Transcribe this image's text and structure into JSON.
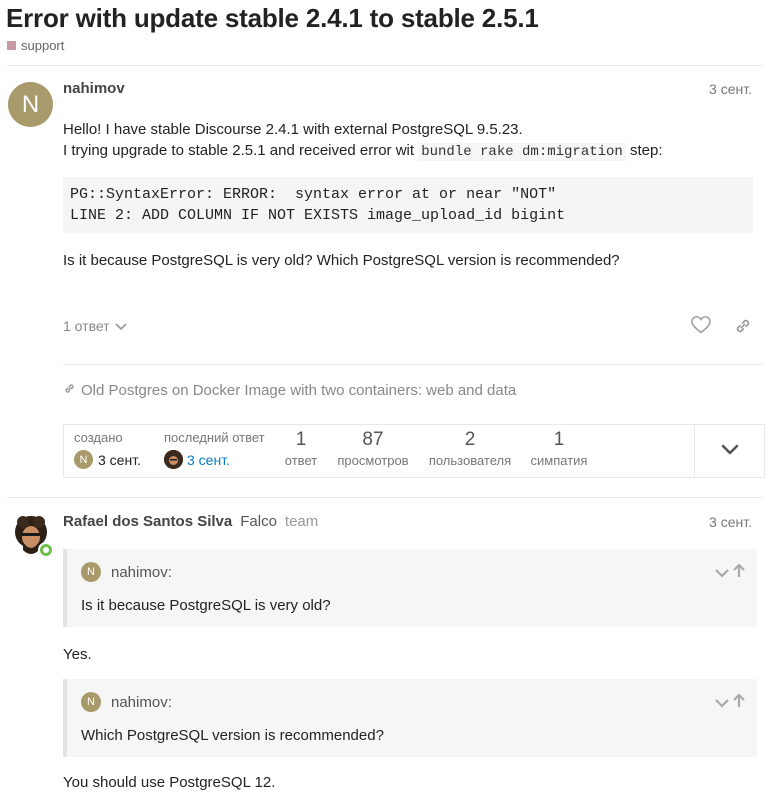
{
  "topic": {
    "title": "Error with update stable 2.4.1 to stable 2.5.1",
    "category": "support",
    "category_color": "#c99aa4"
  },
  "post1": {
    "avatar_letter": "N",
    "avatar_color": "#a89a6a",
    "username": "nahimov",
    "date": "3 сент.",
    "line1": "Hello! I have stable Discourse 2.4.1 with external PostgreSQL 9.5.23.",
    "line2_before": "I trying upgrade to stable 2.5.1 and received error wit ",
    "line2_code": "bundle rake dm:migration",
    "line2_after": " step:",
    "code_line1": "PG::SyntaxError: ERROR:  syntax error at or near \"NOT\"",
    "code_line2": "LINE 2: ADD COLUMN IF NOT EXISTS image_upload_id bigint",
    "question": "Is it because PostgreSQL is very old? Which PostgreSQL version is recommended?",
    "replies_label": "1 ответ",
    "link_text": "Old Postgres on Docker Image with two containers: web and data"
  },
  "stats": {
    "created_label": "создано",
    "created_date": "3 сент.",
    "last_reply_label": "последний ответ",
    "last_reply_date": "3 сент.",
    "replies_count": "1",
    "replies_label": "ответ",
    "views_count": "87",
    "views_label": "просмотров",
    "users_count": "2",
    "users_label": "пользователя",
    "likes_count": "1",
    "likes_label": "симпатия"
  },
  "post2": {
    "username": "Rafael dos Santos Silva",
    "title": "Falco",
    "group": "team",
    "date": "3 сент.",
    "quote1_user": "nahimov:",
    "quote1_text": "Is it because PostgreSQL is very old?",
    "answer1": "Yes.",
    "quote2_user": "nahimov:",
    "quote2_text": "Which PostgreSQL version is recommended?",
    "answer2": "You should use PostgreSQL 12."
  },
  "icons": {
    "heart": "heart-icon",
    "link": "link-icon",
    "chevron": "chevron-down-icon",
    "arrow_up": "arrow-up-icon"
  },
  "colors": {
    "link_blue": "#0a7bc2"
  }
}
